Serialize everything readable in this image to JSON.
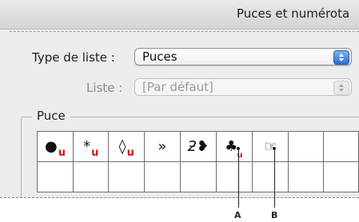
{
  "dialog": {
    "title": "Puces et numérota",
    "type_label": "Type de liste :",
    "type_value": "Puces",
    "list_label": "Liste :",
    "list_value": "[Par défaut]"
  },
  "bullet_group": {
    "label": "Puce",
    "row1": [
      {
        "glyph": "●",
        "mark": "u"
      },
      {
        "glyph": "*",
        "mark": "u"
      },
      {
        "glyph": "◊",
        "mark": "u"
      },
      {
        "glyph": "»",
        "mark": ""
      },
      {
        "glyph": "ƻ❥",
        "mark": ""
      },
      {
        "glyph": "♣",
        "mark": "u"
      },
      {
        "glyph": "☞",
        "mark": ""
      },
      {
        "glyph": "",
        "mark": ""
      },
      {
        "glyph": "",
        "mark": ""
      }
    ]
  },
  "callouts": {
    "a": "A",
    "b": "B"
  },
  "colors": {
    "u_mark": "#d21414",
    "popup_arrow": "#2a6fd1"
  },
  "icons": {
    "popup_arrows": "up-down-arrows-icon"
  }
}
